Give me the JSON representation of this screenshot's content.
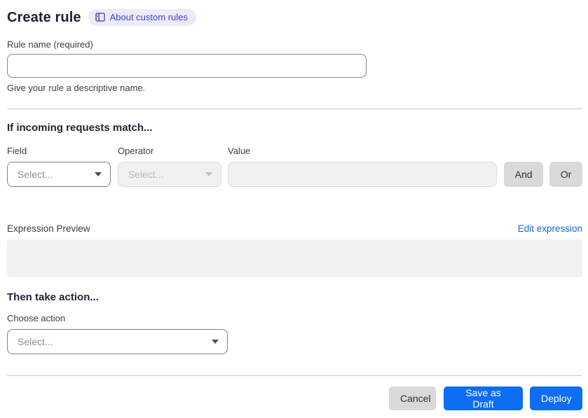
{
  "header": {
    "title": "Create rule",
    "about_badge_label": "About custom rules"
  },
  "rule_name": {
    "label": "Rule name (required)",
    "value": "",
    "helper": "Give your rule a descriptive name."
  },
  "match_section": {
    "heading": "If incoming requests match...",
    "field_label": "Field",
    "operator_label": "Operator",
    "value_label": "Value",
    "field_placeholder": "Select...",
    "operator_placeholder": "Select...",
    "value_text": "",
    "and_button": "And",
    "or_button": "Or",
    "expression_preview_label": "Expression Preview",
    "edit_expression_link": "Edit expression",
    "expression_value": ""
  },
  "action_section": {
    "heading": "Then take action...",
    "choose_label": "Choose action",
    "action_placeholder": "Select..."
  },
  "footer": {
    "cancel_label": "Cancel",
    "save_draft_label": "Save as Draft",
    "deploy_label": "Deploy"
  },
  "icons": {
    "about_badge_icon": "book-icon",
    "select_caret": "chevron-down-icon"
  },
  "colors": {
    "primary_blue": "#0d6df4",
    "link_blue": "#1967d2",
    "badge_bg": "#eceafb",
    "badge_text": "#4347c2",
    "disabled_bg": "#f0f0f0",
    "neutral_button_bg": "#d9d9d9",
    "preview_bg": "#f1f1f1"
  }
}
